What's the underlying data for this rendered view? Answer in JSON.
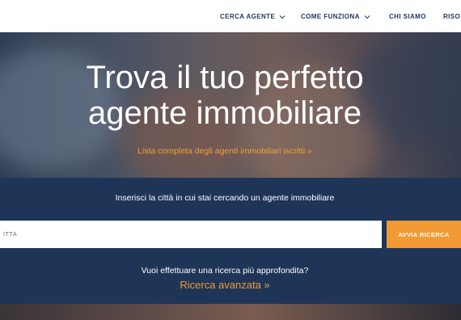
{
  "nav": {
    "items": [
      {
        "label": "CERCA AGENTE",
        "dropdown": true
      },
      {
        "label": "COME FUNZIONA",
        "dropdown": true
      },
      {
        "label": "CHI SIAMO",
        "dropdown": false
      },
      {
        "label": "RISO",
        "dropdown": false
      }
    ],
    "chevron_icon": "chevron-down-icon",
    "text_color": "#25385a"
  },
  "hero": {
    "title": "Trova il tuo perfetto\nagente immobiliare",
    "link_text": "Lista completa degli agenti immobiliari iscritti »"
  },
  "search": {
    "prompt": "Inserisci la città in cui stai cercando un agente immobiliare",
    "input_placeholder": "ITTÀ",
    "input_value": "",
    "button_label": "AVVIA RICERCA"
  },
  "advanced": {
    "question": "Vuoi effettuare una ricerca più approfondita?",
    "link_text": "Ricerca avanzata »"
  },
  "colors": {
    "band": "#1e3558",
    "accent": "#f29a33",
    "link": "#f0a030"
  }
}
